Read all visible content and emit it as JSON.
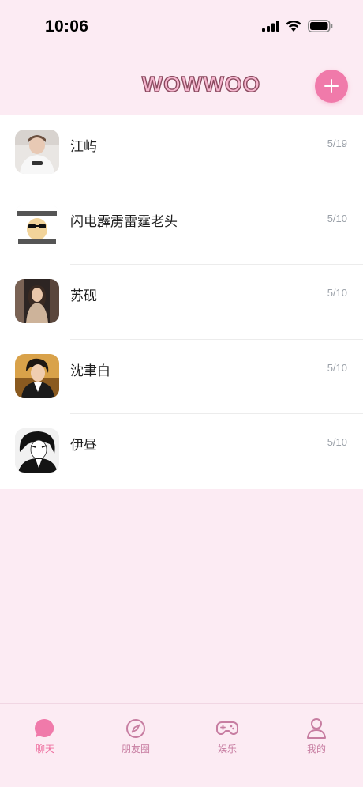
{
  "status_bar": {
    "time": "10:06"
  },
  "header": {
    "logo_text": "WOWWOO",
    "add_icon": "plus-icon"
  },
  "chats": [
    {
      "name": "江屿",
      "date": "5/19",
      "avatar": "avatar-photo-white-sweater"
    },
    {
      "name": "闪电霹雳雷霆老头",
      "date": "5/10",
      "avatar": "avatar-meme-sunglasses"
    },
    {
      "name": "苏砚",
      "date": "5/10",
      "avatar": "avatar-photo-woman"
    },
    {
      "name": "沈聿白",
      "date": "5/10",
      "avatar": "avatar-anime-suit-man"
    },
    {
      "name": "伊昼",
      "date": "5/10",
      "avatar": "avatar-anime-monochrome"
    }
  ],
  "tabs": [
    {
      "label": "聊天",
      "icon": "chat-bubble-icon",
      "active": true
    },
    {
      "label": "朋友圈",
      "icon": "compass-icon",
      "active": false
    },
    {
      "label": "娱乐",
      "icon": "gamepad-icon",
      "active": false
    },
    {
      "label": "我的",
      "icon": "person-icon",
      "active": false
    }
  ],
  "colors": {
    "accent": "#f07aaa",
    "background": "#fcebf3",
    "tab_inactive": "#c77da1"
  }
}
